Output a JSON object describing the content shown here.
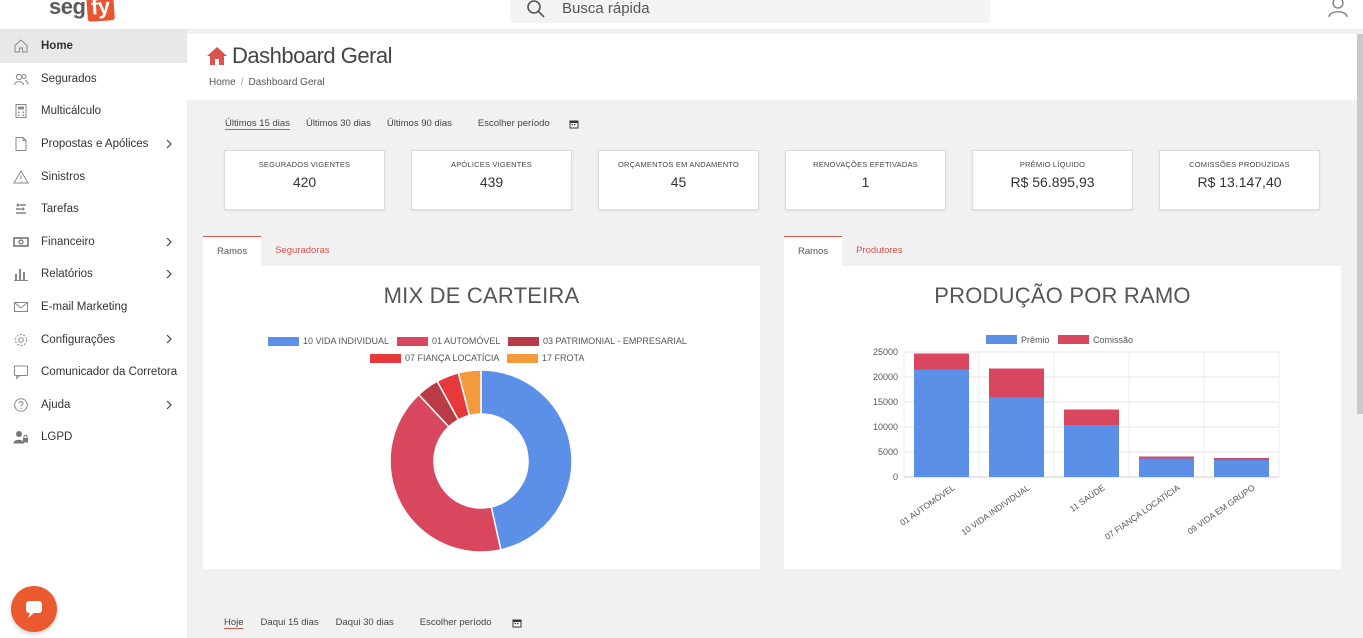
{
  "app": {
    "logo_part1": "seg",
    "logo_part2": "fy",
    "search_placeholder": "Busca rápida"
  },
  "sidebar": {
    "items": [
      {
        "label": "Home",
        "icon": "home-icon",
        "active": true,
        "has_children": false
      },
      {
        "label": "Segurados",
        "icon": "users-icon",
        "active": false,
        "has_children": false
      },
      {
        "label": "Multicálculo",
        "icon": "calculator-icon",
        "active": false,
        "has_children": false
      },
      {
        "label": "Propostas e Apólices",
        "icon": "document-icon",
        "active": false,
        "has_children": true
      },
      {
        "label": "Sinistros",
        "icon": "warning-icon",
        "active": false,
        "has_children": false
      },
      {
        "label": "Tarefas",
        "icon": "tasks-icon",
        "active": false,
        "has_children": false
      },
      {
        "label": "Financeiro",
        "icon": "money-icon",
        "active": false,
        "has_children": true
      },
      {
        "label": "Relatórios",
        "icon": "bar-chart-icon",
        "active": false,
        "has_children": true
      },
      {
        "label": "E-mail Marketing",
        "icon": "envelope-icon",
        "active": false,
        "has_children": false
      },
      {
        "label": "Configurações",
        "icon": "gear-icon",
        "active": false,
        "has_children": true
      },
      {
        "label": "Comunicador da Corretora",
        "icon": "chat-icon",
        "active": false,
        "has_children": false
      },
      {
        "label": "Ajuda",
        "icon": "help-icon",
        "active": false,
        "has_children": true
      },
      {
        "label": "LGPD",
        "icon": "user-lock-icon",
        "active": false,
        "has_children": false
      }
    ]
  },
  "header": {
    "title": "Dashboard Geral",
    "breadcrumb": [
      "Home",
      "Dashboard Geral"
    ]
  },
  "period_filter": {
    "options": [
      "Últimos 15 dias",
      "Últimos 30 dias",
      "Últimos 90 dias",
      "Escolher período"
    ],
    "selected": 0
  },
  "stats": [
    {
      "label": "SEGURADOS VIGENTES",
      "value": "420"
    },
    {
      "label": "APÓLICES VIGENTES",
      "value": "439"
    },
    {
      "label": "ORÇAMENTOS EM ANDAMENTO",
      "value": "45"
    },
    {
      "label": "RENOVAÇÕES EFETIVADAS",
      "value": "1"
    },
    {
      "label": "PRÊMIO LÍQUIDO",
      "value": "R$ 56.895,93"
    },
    {
      "label": "COMISSÕES PRODUZIDAS",
      "value": "R$ 13.147,40"
    }
  ],
  "left_panel": {
    "tabs": [
      "Ramos",
      "Seguradoras"
    ],
    "title": "MIX DE CARTEIRA"
  },
  "right_panel": {
    "tabs": [
      "Ramos",
      "Produtores"
    ],
    "title": "PRODUÇÃO POR RAMO"
  },
  "chart_data": [
    {
      "type": "pie",
      "title": "MIX DE CARTEIRA",
      "categories": [
        "10 VIDA INDIVIDUAL",
        "01 AUTOMÓVEL",
        "03 PATRIMONIAL - EMPRESARIAL",
        "07 FIANÇA LOCATÍCIA",
        "17 FROTA"
      ],
      "values": [
        46.5,
        41.5,
        4,
        4,
        4
      ],
      "colors": [
        "#5b8fe8",
        "#d9475f",
        "#b83b45",
        "#e63a3a",
        "#f39a3c"
      ],
      "legend": "top"
    },
    {
      "type": "bar",
      "stacked": true,
      "title": "PRODUÇÃO POR RAMO",
      "categories": [
        "01 AUTOMÓVEL",
        "10 VIDA INDIVIDUAL",
        "11 SAÚDE",
        "07 FIANÇA LOCATÍCIA",
        "09 VIDA EM GRUPO"
      ],
      "series": [
        {
          "name": "Prêmio",
          "values": [
            21500,
            15900,
            10400,
            3700,
            3400
          ],
          "color": "#5b8fe8"
        },
        {
          "name": "Comissão",
          "values": [
            3200,
            5800,
            3100,
            400,
            400
          ],
          "color": "#d9475f"
        }
      ],
      "yticks": [
        "25000",
        "20000",
        "15000",
        "10000",
        "5000",
        "0"
      ],
      "ylim": [
        0,
        25000
      ],
      "legend": "top",
      "grid": true
    }
  ],
  "bottom_filter": {
    "options": [
      "Hoje",
      "Daqui 15 dias",
      "Daqui 30 dias",
      "Escolher período"
    ],
    "selected": 0
  }
}
